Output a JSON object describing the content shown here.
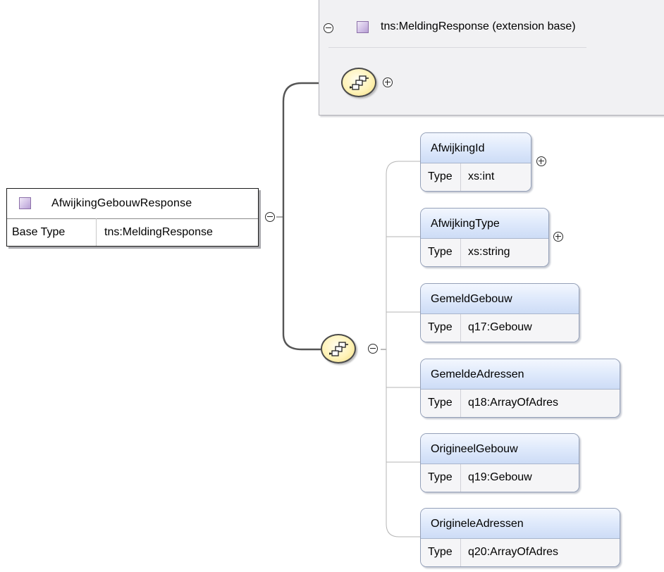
{
  "extension": {
    "title": "tns:MeldingResponse (extension base)"
  },
  "root": {
    "name": "AfwijkingGebouwResponse",
    "base_type_label": "Base Type",
    "base_type_value": "tns:MeldingResponse"
  },
  "children": [
    {
      "name": "AfwijkingId",
      "type_label": "Type",
      "type_value": "xs:int",
      "expandable": true
    },
    {
      "name": "AfwijkingType",
      "type_label": "Type",
      "type_value": "xs:string",
      "expandable": true
    },
    {
      "name": "GemeldGebouw",
      "type_label": "Type",
      "type_value": "q17:Gebouw",
      "expandable": false
    },
    {
      "name": "GemeldeAdressen",
      "type_label": "Type",
      "type_value": "q18:ArrayOfAdres",
      "expandable": false
    },
    {
      "name": "OrigineelGebouw",
      "type_label": "Type",
      "type_value": "q19:Gebouw",
      "expandable": false
    },
    {
      "name": "OrigineleAdressen",
      "type_label": "Type",
      "type_value": "q20:ArrayOfAdres",
      "expandable": false
    }
  ],
  "colors": {
    "compositor_fill": "#fff3b8",
    "card_header": "#dde8fb",
    "panel_bg": "#f1f1f3",
    "type_icon": "#d2c1e6"
  },
  "icons": [
    "collapse-icon",
    "expand-icon",
    "complex-type-icon",
    "sequence-icon"
  ]
}
